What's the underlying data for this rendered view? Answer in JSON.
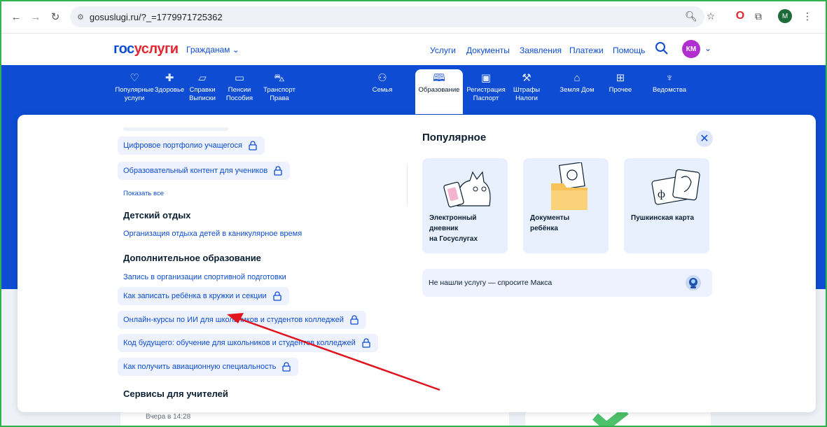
{
  "browser": {
    "url": "gosuslugi.ru/?_=1779971725362",
    "profile_initial": "M"
  },
  "header": {
    "logo_part1": "гос",
    "logo_part2": "услуги",
    "audience": "Гражданам",
    "nav": [
      "Услуги",
      "Документы",
      "Заявления",
      "Платежи",
      "Помощь"
    ],
    "avatar": "КМ"
  },
  "categories": [
    {
      "line1": "Популярные",
      "line2": "услуги",
      "icon": "heart-icon"
    },
    {
      "line1": "Здоровье",
      "line2": "",
      "icon": "health-cross-icon"
    },
    {
      "line1": "Справки",
      "line2": "Выписки",
      "icon": "folder-icon"
    },
    {
      "line1": "Пенсии",
      "line2": "Пособия",
      "icon": "wallet-icon"
    },
    {
      "line1": "Транспорт",
      "line2": "Права",
      "icon": "car-icon"
    },
    {
      "line1": "Семья",
      "line2": "",
      "icon": "stroller-icon"
    },
    {
      "line1": "Образование",
      "line2": "",
      "icon": "book-icon"
    },
    {
      "line1": "Регистрация",
      "line2": "Паспорт",
      "icon": "passport-icon"
    },
    {
      "line1": "Штрафы",
      "line2": "Налоги",
      "icon": "gavel-icon"
    },
    {
      "line1": "Земля Дом",
      "line2": "",
      "icon": "house-icon"
    },
    {
      "line1": "Прочее",
      "line2": "",
      "icon": "grid-icon"
    },
    {
      "line1": "Ведомства",
      "line2": "",
      "icon": "emblem-icon"
    }
  ],
  "active_category": "Образование",
  "menu": {
    "chips_top": [
      "Цифровое портфолио учащегося",
      "Образовательный контент для учеников"
    ],
    "show_all": "Показать все",
    "section_rest": "Детский отдых",
    "rest_link": "Организация отдыха детей в каникулярное время",
    "section_extra": "Дополнительное образование",
    "extra_link": "Запись в организации спортивной подготовки",
    "chips_bottom": [
      "Как записать ребёнка в кружки и секции",
      "Онлайн-курсы по ИИ для школьников и студентов колледжей",
      "Код будущего: обучение для школьников и студентов колледжей",
      "Как получить авиационную специальность"
    ],
    "section_teachers": "Сервисы для учителей"
  },
  "popular": {
    "title": "Популярное",
    "cards": [
      {
        "line1": "Электронный",
        "line2": "дневник",
        "line3": "на Госуслугах"
      },
      {
        "line1": "Документы",
        "line2": "ребёнка",
        "line3": ""
      },
      {
        "line1": "Пушкинская карта",
        "line2": "",
        "line3": ""
      }
    ],
    "ask": "Не нашли услугу — спросите Макса"
  },
  "background": {
    "timestamp": "Вчера в 14:28"
  },
  "colors": {
    "brand_blue": "#0d4cd3",
    "brand_red": "#e3262f",
    "annotation_arrow": "#e0141e"
  }
}
